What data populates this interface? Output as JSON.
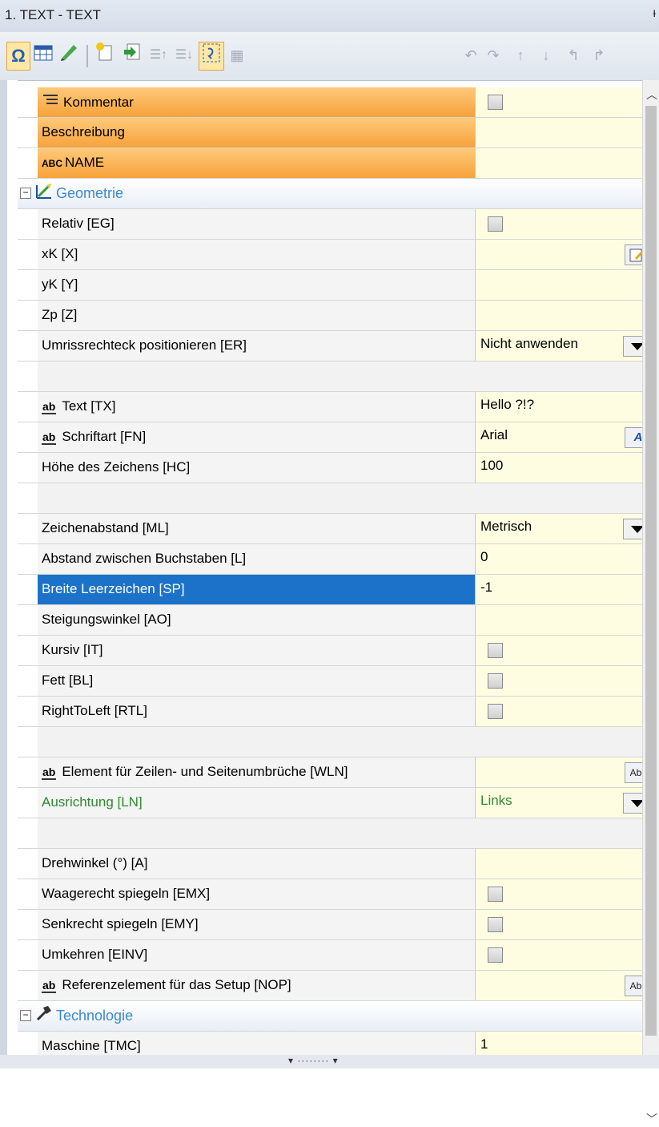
{
  "window": {
    "title": "1. TEXT - TEXT",
    "pin_glyph": "ᵼ"
  },
  "toolbar": {
    "left_icons": [
      "omega-icon",
      "table-icon",
      "pencil-icon",
      "new-item-icon",
      "insert-icon",
      "move-up-icon",
      "move-down-icon",
      "select-icon",
      "grid-icon"
    ],
    "right_icons": [
      "undo-icon",
      "redo-icon",
      "step-up-icon",
      "step-down-icon",
      "back-icon",
      "forward-icon"
    ]
  },
  "rows": {
    "kommentar": {
      "label": "Kommentar"
    },
    "beschreibung": {
      "label": "Beschreibung"
    },
    "name": {
      "label": "NAME",
      "prefix": "ABC"
    },
    "geometrie": {
      "label": "Geometrie"
    },
    "relativ": {
      "label": "Relativ [EG]"
    },
    "xk": {
      "label": "xK [X]"
    },
    "yk": {
      "label": "yK [Y]"
    },
    "zp": {
      "label": "Zp [Z]"
    },
    "umriss": {
      "label": "Umrissrechteck positionieren [ER]",
      "value": "Nicht anwenden"
    },
    "text": {
      "label": "Text [TX]",
      "value": "Hello ?!?"
    },
    "schriftart": {
      "label": "Schriftart [FN]",
      "value": "Arial"
    },
    "hoehe": {
      "label": "Höhe des Zeichens [HC]",
      "value": "100"
    },
    "zeichenabstand": {
      "label": "Zeichenabstand [ML]",
      "value": "Metrisch"
    },
    "abstand": {
      "label": "Abstand zwischen Buchstaben [L]",
      "value": "0"
    },
    "breite": {
      "label": "Breite Leerzeichen [SP]",
      "value": "-1"
    },
    "steigung": {
      "label": "Steigungswinkel [AO]",
      "value": ""
    },
    "kursiv": {
      "label": "Kursiv [IT]"
    },
    "fett": {
      "label": "Fett [BL]"
    },
    "rtl": {
      "label": "RightToLeft [RTL]"
    },
    "element": {
      "label": "Element für Zeilen- und Seitenumbrüche [WLN]"
    },
    "ausrichtung": {
      "label": "Ausrichtung [LN]",
      "value": "Links"
    },
    "drehwinkel": {
      "label": "Drehwinkel (°) [A]",
      "value": ""
    },
    "waagerecht": {
      "label": "Waagerecht spiegeln [EMX]"
    },
    "senkrecht": {
      "label": "Senkrecht spiegeln [EMY]"
    },
    "umkehren": {
      "label": "Umkehren [EINV]"
    },
    "referenz": {
      "label": "Referenzelement für das Setup [NOP]"
    },
    "technologie": {
      "label": "Technologie"
    },
    "maschine": {
      "label": "Maschine [TMC]",
      "value": "1"
    }
  },
  "glyphs": {
    "ab": "ab",
    "abc_button": "Abc",
    "expander": "−"
  }
}
